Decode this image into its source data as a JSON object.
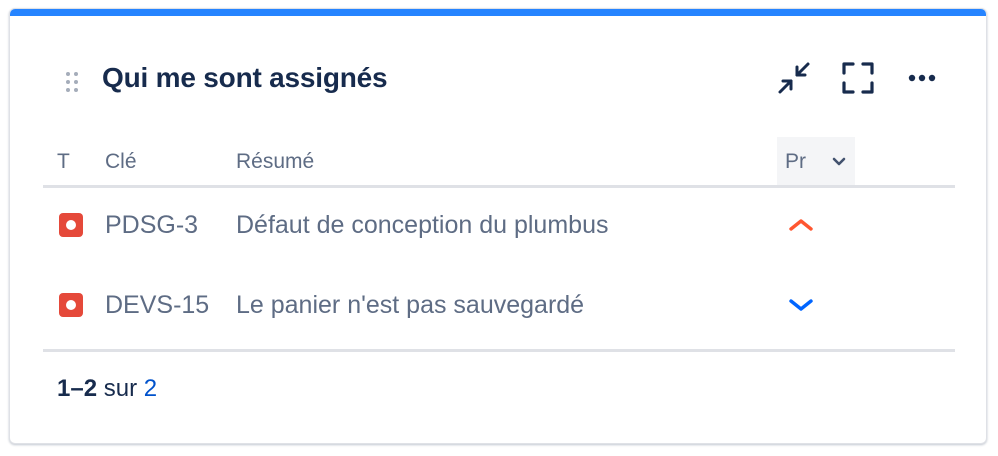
{
  "gadget": {
    "title": "Qui me sont assignés",
    "accent_color": "#2684ff",
    "toolbar": {
      "minimize_icon": "minimize-arrows-icon",
      "fullscreen_icon": "fullscreen-icon",
      "more_icon": "more-horizontal-icon"
    }
  },
  "table": {
    "columns": {
      "type": "T",
      "key": "Clé",
      "summary": "Résumé",
      "priority": "Pr"
    },
    "rows": [
      {
        "type_icon": "bug-icon",
        "key": "PDSG-3",
        "summary": "Défaut de conception du plumbus",
        "priority": "high",
        "priority_icon": "priority-high-icon",
        "priority_color": "#ff5630"
      },
      {
        "type_icon": "bug-icon",
        "key": "DEVS-15",
        "summary": "Le panier n'est pas sauvegardé",
        "priority": "low",
        "priority_icon": "priority-low-icon",
        "priority_color": "#0065ff"
      }
    ]
  },
  "pagination": {
    "range": "1–2",
    "separator": "sur",
    "total": "2"
  }
}
